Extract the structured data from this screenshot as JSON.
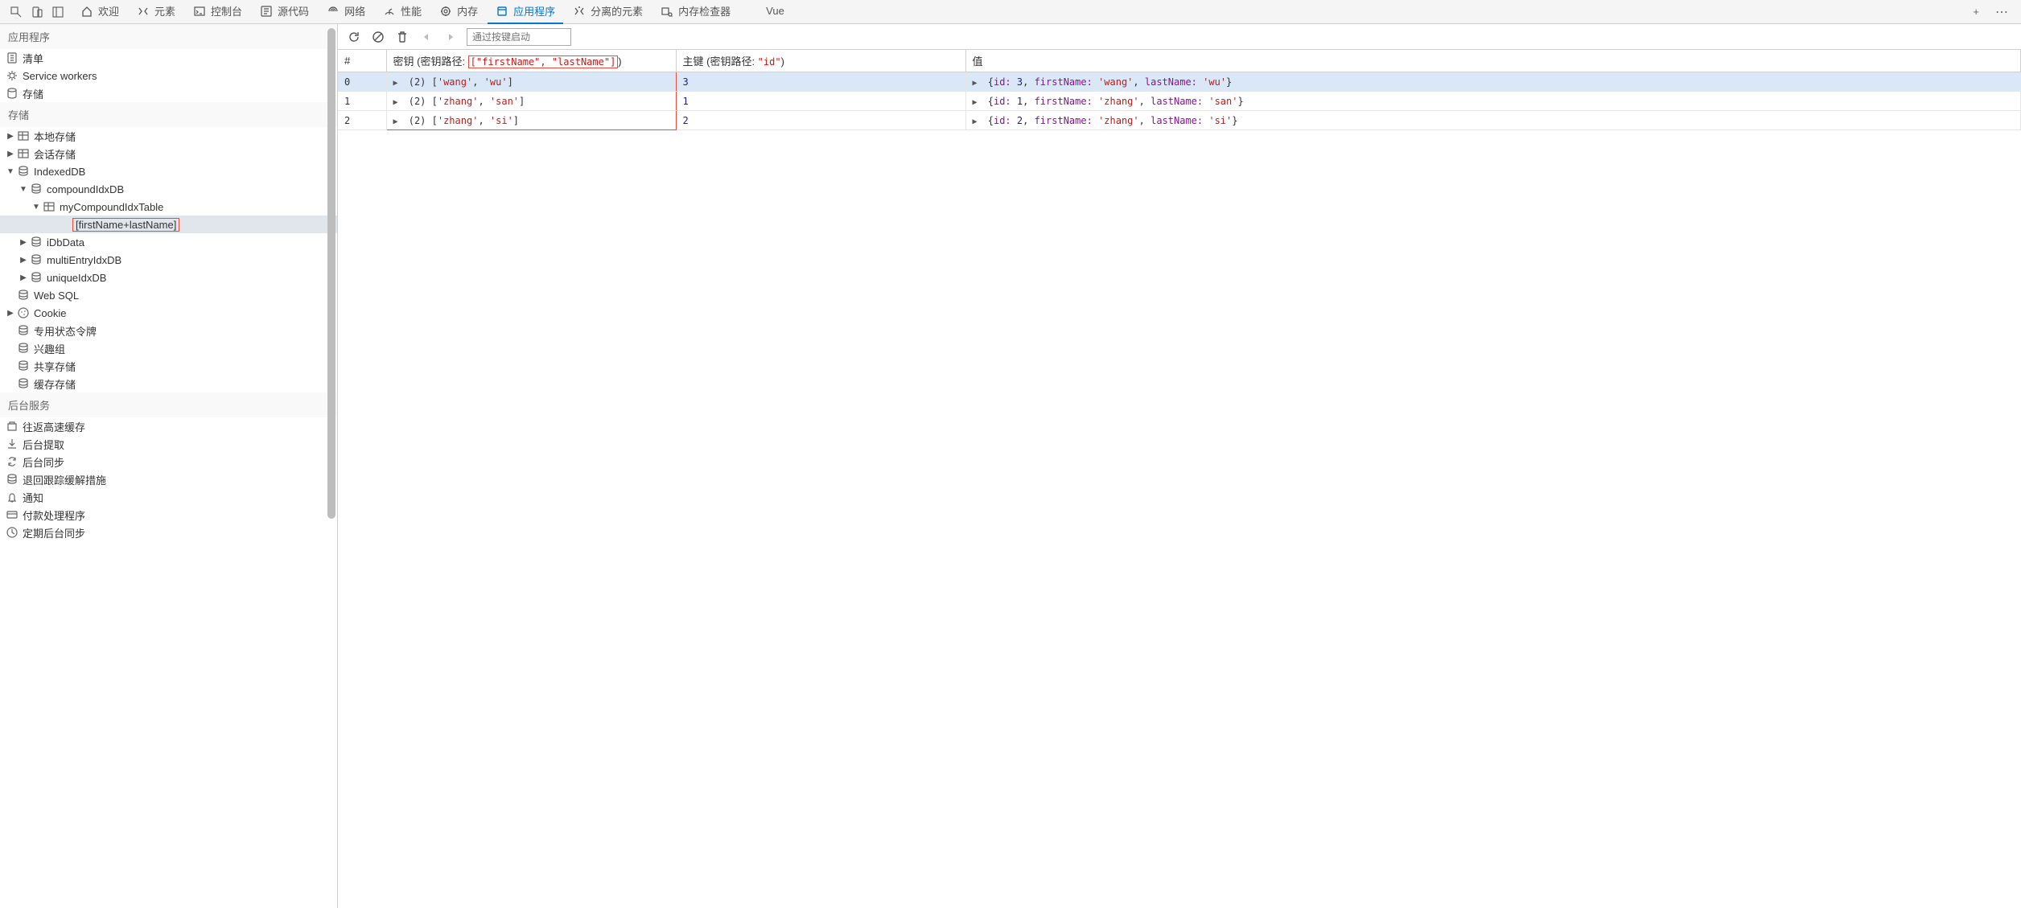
{
  "topbar": {
    "tabs": [
      {
        "label": "欢迎",
        "icon": "home"
      },
      {
        "label": "元素",
        "icon": "elements"
      },
      {
        "label": "控制台",
        "icon": "console"
      },
      {
        "label": "源代码",
        "icon": "sources"
      },
      {
        "label": "网络",
        "icon": "network"
      },
      {
        "label": "性能",
        "icon": "performance"
      },
      {
        "label": "内存",
        "icon": "memory"
      },
      {
        "label": "应用程序",
        "icon": "application",
        "active": true
      },
      {
        "label": "分离的元素",
        "icon": "detached"
      },
      {
        "label": "内存检查器",
        "icon": "meminspect"
      },
      {
        "label": "Vue",
        "icon": "vue"
      }
    ],
    "add": "+",
    "more": "⋯"
  },
  "sidebar": {
    "application_header": "应用程序",
    "app_items": [
      {
        "label": "清单",
        "icon": "manifest"
      },
      {
        "label": "Service workers",
        "icon": "serviceworker"
      },
      {
        "label": "存储",
        "icon": "storage"
      }
    ],
    "storage_header": "存储",
    "storage_tree": [
      {
        "label": "本地存储",
        "icon": "table",
        "indent": 0,
        "arrow": "right"
      },
      {
        "label": "会话存储",
        "icon": "table",
        "indent": 0,
        "arrow": "right"
      },
      {
        "label": "IndexedDB",
        "icon": "db",
        "indent": 0,
        "arrow": "down"
      },
      {
        "label": "compoundIdxDB",
        "icon": "db",
        "indent": 1,
        "arrow": "down"
      },
      {
        "label": "myCompoundIdxTable",
        "icon": "table",
        "indent": 2,
        "arrow": "down"
      },
      {
        "label": "[firstName+lastName]",
        "icon": "",
        "indent": 3,
        "selected": true,
        "redbox": true
      },
      {
        "label": "iDbData",
        "icon": "db",
        "indent": 1,
        "arrow": "right"
      },
      {
        "label": "multiEntryIdxDB",
        "icon": "db",
        "indent": 1,
        "arrow": "right"
      },
      {
        "label": "uniqueIdxDB",
        "icon": "db",
        "indent": 1,
        "arrow": "right"
      },
      {
        "label": "Web SQL",
        "icon": "db",
        "indent": 0
      },
      {
        "label": "Cookie",
        "icon": "cookie",
        "indent": 0,
        "arrow": "right"
      },
      {
        "label": "专用状态令牌",
        "icon": "db",
        "indent": 0
      },
      {
        "label": "兴趣组",
        "icon": "db",
        "indent": 0
      },
      {
        "label": "共享存储",
        "icon": "db",
        "indent": 0
      },
      {
        "label": "缓存存储",
        "icon": "db",
        "indent": 0
      }
    ],
    "background_header": "后台服务",
    "background_items": [
      {
        "label": "往返高速缓存",
        "icon": "cache"
      },
      {
        "label": "后台提取",
        "icon": "fetch"
      },
      {
        "label": "后台同步",
        "icon": "sync"
      },
      {
        "label": "退回跟踪缓解措施",
        "icon": "db"
      },
      {
        "label": "通知",
        "icon": "bell"
      },
      {
        "label": "付款处理程序",
        "icon": "payment"
      },
      {
        "label": "定期后台同步",
        "icon": "periodic"
      }
    ]
  },
  "toolbar": {
    "filter_placeholder": "通过按键启动"
  },
  "table": {
    "headers": {
      "idx": "#",
      "key_prefix": "密钥 (密钥路径: ",
      "key_path": "[\"firstName\", \"lastName\"]",
      "key_suffix": ")",
      "pk_prefix": "主键 (密钥路径: ",
      "pk_path": "\"id\"",
      "pk_suffix": ")",
      "value": "值"
    },
    "rows": [
      {
        "idx": "0",
        "key_count": "(2)",
        "key_a": "'wang'",
        "key_b": "'wu'",
        "pk": "3",
        "val_id": "3",
        "val_fn": "'wang'",
        "val_ln": "'wu'",
        "highlight": true
      },
      {
        "idx": "1",
        "key_count": "(2)",
        "key_a": "'zhang'",
        "key_b": "'san'",
        "pk": "1",
        "val_id": "1",
        "val_fn": "'zhang'",
        "val_ln": "'san'"
      },
      {
        "idx": "2",
        "key_count": "(2)",
        "key_a": "'zhang'",
        "key_b": "'si'",
        "pk": "2",
        "val_id": "2",
        "val_fn": "'zhang'",
        "val_ln": "'si'"
      }
    ],
    "labels": {
      "id": "id:",
      "firstName": "firstName:",
      "lastName": "lastName:"
    }
  }
}
